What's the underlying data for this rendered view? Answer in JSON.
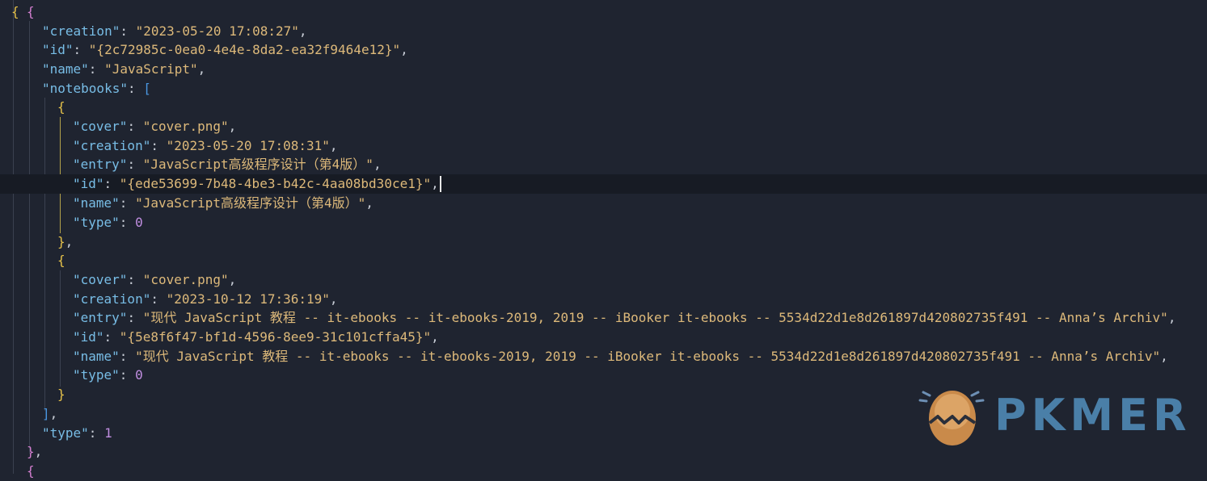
{
  "editor": {
    "lines": [
      {
        "tokens": [
          {
            "t": "{",
            "c": "br-y"
          }
        ]
      },
      {
        "tokens": [
          {
            "t": "{",
            "c": "br-p"
          }
        ]
      },
      {
        "tokens": [
          {
            "t": "\"creation\"",
            "c": "key"
          },
          {
            "t": ": ",
            "c": "pun"
          },
          {
            "t": "\"2023-05-20 17:08:27\"",
            "c": "str"
          },
          {
            "t": ",",
            "c": "pun"
          }
        ]
      },
      {
        "tokens": [
          {
            "t": "\"id\"",
            "c": "key"
          },
          {
            "t": ": ",
            "c": "pun"
          },
          {
            "t": "\"{2c72985c-0ea0-4e4e-8da2-ea32f9464e12}\"",
            "c": "str"
          },
          {
            "t": ",",
            "c": "pun"
          }
        ]
      },
      {
        "tokens": [
          {
            "t": "\"name\"",
            "c": "key"
          },
          {
            "t": ": ",
            "c": "pun"
          },
          {
            "t": "\"JavaScript\"",
            "c": "str"
          },
          {
            "t": ",",
            "c": "pun"
          }
        ]
      },
      {
        "tokens": [
          {
            "t": "\"notebooks\"",
            "c": "key"
          },
          {
            "t": ": ",
            "c": "pun"
          },
          {
            "t": "[",
            "c": "br-b"
          }
        ]
      },
      {
        "tokens": [
          {
            "t": "{",
            "c": "br-y"
          }
        ]
      },
      {
        "tokens": [
          {
            "t": "\"cover\"",
            "c": "key"
          },
          {
            "t": ": ",
            "c": "pun"
          },
          {
            "t": "\"cover.png\"",
            "c": "str"
          },
          {
            "t": ",",
            "c": "pun"
          }
        ]
      },
      {
        "tokens": [
          {
            "t": "\"creation\"",
            "c": "key"
          },
          {
            "t": ": ",
            "c": "pun"
          },
          {
            "t": "\"2023-05-20 17:08:31\"",
            "c": "str"
          },
          {
            "t": ",",
            "c": "pun"
          }
        ]
      },
      {
        "tokens": [
          {
            "t": "\"entry\"",
            "c": "key"
          },
          {
            "t": ": ",
            "c": "pun"
          },
          {
            "t": "\"JavaScript高级程序设计（第4版）\"",
            "c": "str"
          },
          {
            "t": ",",
            "c": "pun"
          }
        ]
      },
      {
        "tokens": [
          {
            "t": "\"id\"",
            "c": "key"
          },
          {
            "t": ": ",
            "c": "pun"
          },
          {
            "t": "\"{ede53699-7b48-4be3-b42c-4aa08bd30ce1}\"",
            "c": "str"
          },
          {
            "t": ",",
            "c": "pun"
          }
        ]
      },
      {
        "tokens": [
          {
            "t": "\"name\"",
            "c": "key"
          },
          {
            "t": ": ",
            "c": "pun"
          },
          {
            "t": "\"JavaScript高级程序设计（第4版）\"",
            "c": "str"
          },
          {
            "t": ",",
            "c": "pun"
          }
        ]
      },
      {
        "tokens": [
          {
            "t": "\"type\"",
            "c": "key"
          },
          {
            "t": ": ",
            "c": "pun"
          },
          {
            "t": "0",
            "c": "num"
          }
        ]
      },
      {
        "tokens": [
          {
            "t": "}",
            "c": "br-y"
          },
          {
            "t": ",",
            "c": "pun"
          }
        ]
      },
      {
        "tokens": [
          {
            "t": "{",
            "c": "br-y"
          }
        ]
      },
      {
        "tokens": [
          {
            "t": "\"cover\"",
            "c": "key"
          },
          {
            "t": ": ",
            "c": "pun"
          },
          {
            "t": "\"cover.png\"",
            "c": "str"
          },
          {
            "t": ",",
            "c": "pun"
          }
        ]
      },
      {
        "tokens": [
          {
            "t": "\"creation\"",
            "c": "key"
          },
          {
            "t": ": ",
            "c": "pun"
          },
          {
            "t": "\"2023-10-12 17:36:19\"",
            "c": "str"
          },
          {
            "t": ",",
            "c": "pun"
          }
        ]
      },
      {
        "tokens": [
          {
            "t": "\"entry\"",
            "c": "key"
          },
          {
            "t": ": ",
            "c": "pun"
          },
          {
            "t": "\"现代 JavaScript 教程 -- it-ebooks -- it-ebooks-2019, 2019 -- iBooker it-ebooks -- 5534d22d1e8d261897d420802735f491 -- Anna’s Archiv\"",
            "c": "str"
          },
          {
            "t": ",",
            "c": "pun"
          }
        ]
      },
      {
        "tokens": [
          {
            "t": "\"id\"",
            "c": "key"
          },
          {
            "t": ": ",
            "c": "pun"
          },
          {
            "t": "\"{5e8f6f47-bf1d-4596-8ee9-31c101cffa45}\"",
            "c": "str"
          },
          {
            "t": ",",
            "c": "pun"
          }
        ]
      },
      {
        "tokens": [
          {
            "t": "\"name\"",
            "c": "key"
          },
          {
            "t": ": ",
            "c": "pun"
          },
          {
            "t": "\"现代 JavaScript 教程 -- it-ebooks -- it-ebooks-2019, 2019 -- iBooker it-ebooks -- 5534d22d1e8d261897d420802735f491 -- Anna’s Archiv\"",
            "c": "str"
          },
          {
            "t": ",",
            "c": "pun"
          }
        ]
      },
      {
        "tokens": [
          {
            "t": "\"type\"",
            "c": "key"
          },
          {
            "t": ": ",
            "c": "pun"
          },
          {
            "t": "0",
            "c": "num"
          }
        ]
      },
      {
        "tokens": [
          {
            "t": "}",
            "c": "br-y"
          }
        ]
      },
      {
        "tokens": [
          {
            "t": "]",
            "c": "br-b"
          },
          {
            "t": ",",
            "c": "pun"
          }
        ]
      },
      {
        "tokens": [
          {
            "t": "\"type\"",
            "c": "key"
          },
          {
            "t": ": ",
            "c": "pun"
          },
          {
            "t": "1",
            "c": "num"
          }
        ]
      },
      {
        "tokens": [
          {
            "t": "}",
            "c": "br-p"
          },
          {
            "t": ",",
            "c": "pun"
          }
        ]
      },
      {
        "tokens": [
          {
            "t": "{",
            "c": "br-p"
          }
        ]
      }
    ]
  },
  "logo": {
    "text": "PKMER",
    "icon": "egg-logo-icon"
  }
}
